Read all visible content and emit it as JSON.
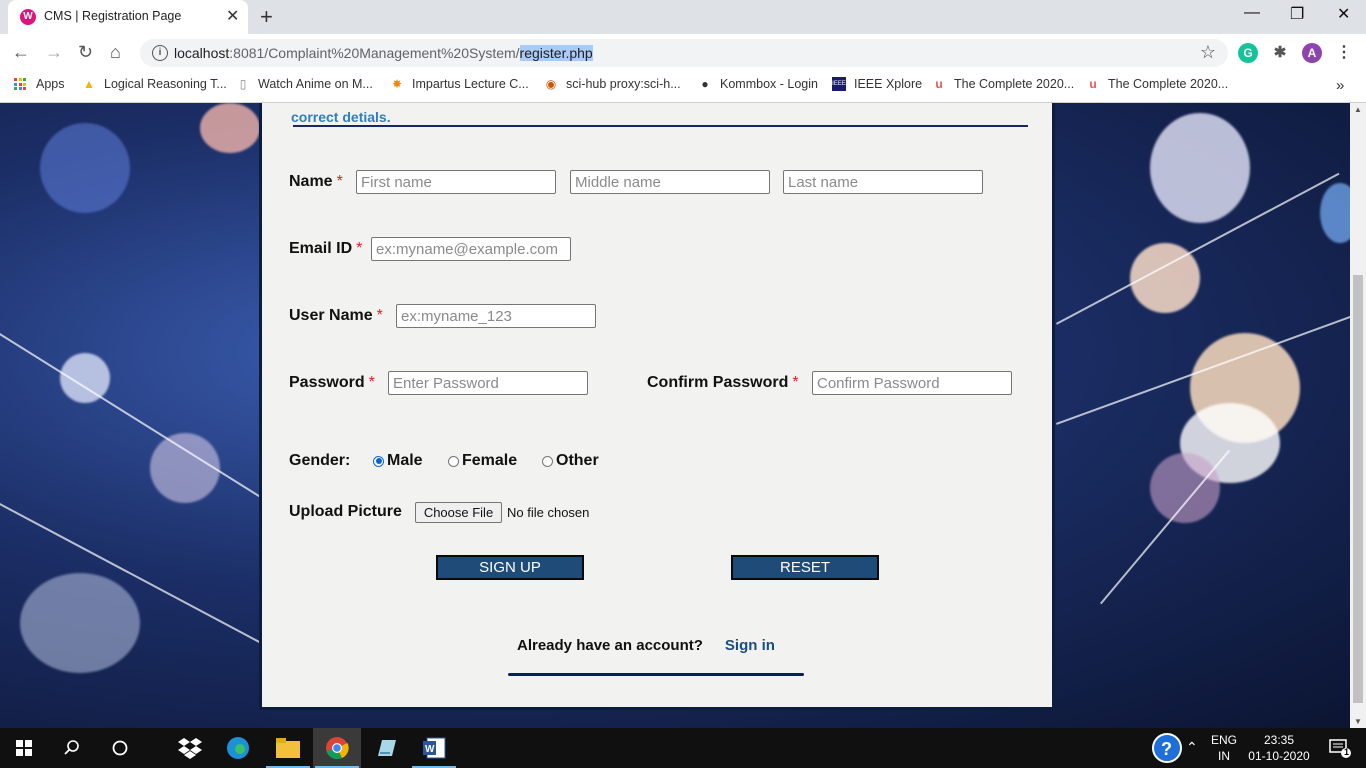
{
  "browser": {
    "tab_title": "CMS | Registration Page",
    "url": {
      "host": "localhost",
      "path_prefix": ":8081/Complaint%20Management%20System/",
      "path_selected": "register.php"
    },
    "profile_initial": "A",
    "bookmarks": [
      {
        "label": "Apps",
        "icon": "apps-grid-icon"
      },
      {
        "label": "Logical Reasoning T...",
        "icon": "triangle-icon"
      },
      {
        "label": "Watch Anime on M...",
        "icon": "page-icon"
      },
      {
        "label": "Impartus Lecture C...",
        "icon": "sun-icon"
      },
      {
        "label": "sci-hub proxy:sci-h...",
        "icon": "eye-icon"
      },
      {
        "label": "Kommbox - Login",
        "icon": "globe-icon"
      },
      {
        "label": "IEEE Xplore",
        "icon": "ieee-icon"
      },
      {
        "label": "The Complete 2020...",
        "icon": "udemy-icon"
      },
      {
        "label": "The Complete 2020...",
        "icon": "udemy-icon"
      }
    ]
  },
  "form": {
    "note": "correct detials.",
    "name_label": "Name",
    "required_mark": "*",
    "first_name_placeholder": "First name",
    "middle_name_placeholder": "Middle name",
    "last_name_placeholder": "Last name",
    "email_label": "Email ID",
    "email_placeholder": "ex:myname@example.com",
    "username_label": "User Name",
    "username_placeholder": "ex:myname_123",
    "password_label": "Password",
    "password_placeholder": "Enter Password",
    "confirm_label": "Confirm Password",
    "confirm_placeholder": "Confirm Password",
    "gender_label": "Gender:",
    "gender_options": [
      "Male",
      "Female",
      "Other"
    ],
    "gender_selected": "Male",
    "upload_label": "Upload Picture",
    "choose_file_label": "Choose File",
    "file_status": "No file chosen",
    "signup_label": "SIGN UP",
    "reset_label": "RESET",
    "have_account_text": "Already have an account?",
    "signin_link": "Sign in"
  },
  "taskbar": {
    "lang_top": "ENG",
    "lang_bottom": "IN",
    "time": "23:35",
    "date": "01-10-2020",
    "notification_count": "1"
  },
  "colors": {
    "panel_bg": "#f2f3f1",
    "button_bg": "#1f4b79",
    "required": "#e02020",
    "note": "#2f7fc1",
    "link": "#1b4c85"
  }
}
